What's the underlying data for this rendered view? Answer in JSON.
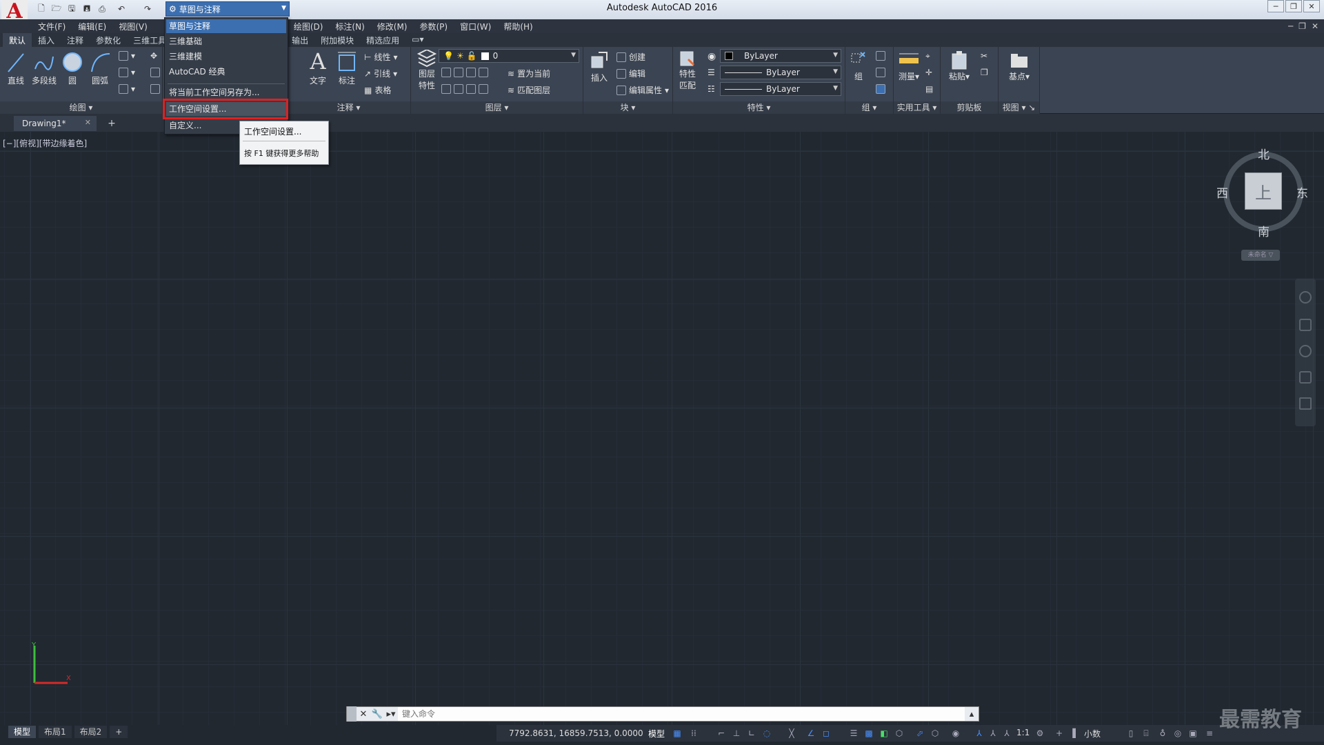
{
  "window": {
    "title": "Autodesk AutoCAD 2016",
    "controls": [
      "─",
      "❐",
      "✕"
    ],
    "doc_controls": [
      "─",
      "❐",
      "✕"
    ]
  },
  "quick_access": {
    "icons": [
      "new-icon",
      "open-icon",
      "save-icon",
      "saveas-icon",
      "print-icon",
      "undo-icon",
      "redo-icon"
    ]
  },
  "workspace": {
    "current": "草图与注释",
    "menu_items": [
      "草图与注释",
      "三维基础",
      "三维建模",
      "AutoCAD 经典",
      "将当前工作空间另存为...",
      "工作空间设置...",
      "自定义..."
    ]
  },
  "tooltip": {
    "title": "工作空间设置...",
    "help": "按 F1 键获得更多帮助"
  },
  "menubar": [
    "文件(F)",
    "编辑(E)",
    "视图(V)",
    "",
    "",
    "",
    "绘图(D)",
    "标注(N)",
    "修改(M)",
    "参数(P)",
    "窗口(W)",
    "帮助(H)"
  ],
  "ribbon_tabs": [
    "默认",
    "插入",
    "注释",
    "参数化",
    "三维工具",
    "",
    "",
    "输出",
    "附加模块",
    "精选应用"
  ],
  "ribbon": {
    "draw": {
      "title": "绘图",
      "tools": [
        "直线",
        "多段线",
        "圆",
        "圆弧"
      ]
    },
    "annotation": {
      "title": "注释",
      "text": "文字",
      "dim": "标注",
      "linear": "线性",
      "leader": "引线",
      "table": "表格"
    },
    "layers": {
      "title": "图层",
      "props_label_1": "图层",
      "props_label_2": "特性",
      "current_layer": "0",
      "set_current": "置为当前",
      "match_layer": "匹配图层"
    },
    "block": {
      "title": "块",
      "insert": "插入",
      "create": "创建",
      "edit": "编辑",
      "edit_attr": "编辑属性"
    },
    "properties": {
      "title": "特性",
      "match_1": "特性",
      "match_2": "匹配",
      "color": "ByLayer",
      "linetype": "ByLayer",
      "lineweight": "ByLayer"
    },
    "groups": {
      "title": "组",
      "group": "组"
    },
    "utilities": {
      "title": "实用工具",
      "measure": "测量"
    },
    "clipboard": {
      "title": "剪贴板",
      "paste": "粘贴"
    },
    "view": {
      "title": "视图",
      "base": "基点"
    }
  },
  "doc_tab": {
    "name": "Drawing1*"
  },
  "viewport_label": "[−][俯视][带边缘着色]",
  "viewcube": {
    "north": "北",
    "south": "南",
    "east": "东",
    "west": "西",
    "face": "上",
    "wcs": "未命名 ▽"
  },
  "command": {
    "placeholder": "键入命令"
  },
  "layout_tabs": [
    "模型",
    "布局1",
    "布局2"
  ],
  "status": {
    "coords": "7792.8631, 16859.7513, 0.0000",
    "mode": "模型",
    "scale": "1:1",
    "units": "小数"
  },
  "watermark": "最需教育"
}
